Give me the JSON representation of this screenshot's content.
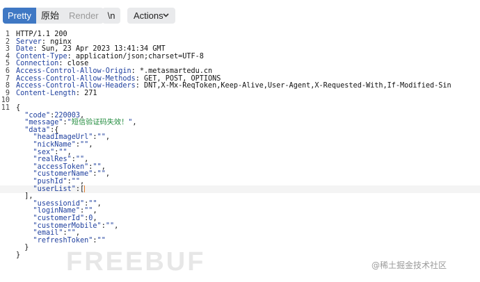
{
  "toolbar": {
    "tabs": [
      "Pretty",
      "原始",
      "Render"
    ],
    "newline_label": "\\n",
    "actions_label": "Actions"
  },
  "headers": [
    {
      "n": "1",
      "text": "HTTP/1.1 200"
    },
    {
      "n": "2",
      "name": "Server",
      "value": " nginx"
    },
    {
      "n": "3",
      "name": "Date",
      "value": " Sun, 23 Apr 2023 13:41:34 GMT"
    },
    {
      "n": "4",
      "name": "Content-Type",
      "value": " application/json;charset=UTF-8"
    },
    {
      "n": "5",
      "name": "Connection",
      "value": " close"
    },
    {
      "n": "6",
      "name": "Access-Control-Allow-Origin",
      "value": " *.metasmartedu.cn"
    },
    {
      "n": "7",
      "name": "Access-Control-Allow-Methods",
      "value": " GET, POST, OPTIONS"
    },
    {
      "n": "8",
      "name": "Access-Control-Allow-Headers",
      "value": " DNT,X-Mx-ReqToken,Keep-Alive,User-Agent,X-Requested-With,If-Modified-Sin"
    },
    {
      "n": "9",
      "name": "Content-Length",
      "value": " 271"
    },
    {
      "n": "10",
      "text": ""
    }
  ],
  "json_lines": [
    {
      "n": "11",
      "indent": "",
      "open": "{"
    },
    {
      "n": "",
      "indent": "  ",
      "key": "code",
      "num": "220003",
      "tail": ","
    },
    {
      "n": "",
      "indent": "  ",
      "key": "message",
      "str": "短信验证码失效！",
      "tail": ","
    },
    {
      "n": "",
      "indent": "  ",
      "key": "data",
      "tail": "{"
    },
    {
      "n": "",
      "indent": "    ",
      "key": "headImageUrl",
      "str": "",
      "tail": ","
    },
    {
      "n": "",
      "indent": "    ",
      "key": "nickName",
      "str": "",
      "tail": ","
    },
    {
      "n": "",
      "indent": "    ",
      "key": "sex",
      "str": "",
      "tail": ","
    },
    {
      "n": "",
      "indent": "    ",
      "key": "realRes",
      "str": "",
      "tail": ","
    },
    {
      "n": "",
      "indent": "    ",
      "key": "accessToken",
      "str": "",
      "tail": ","
    },
    {
      "n": "",
      "indent": "    ",
      "key": "customerName",
      "str": "",
      "tail": ","
    },
    {
      "n": "",
      "indent": "    ",
      "key": "pushId",
      "str": "",
      "tail": ","
    },
    {
      "n": "",
      "indent": "    ",
      "key": "userList",
      "tail": "[",
      "cursor": true,
      "hl": true
    },
    {
      "n": "",
      "indent": "  ",
      "open": "],"
    },
    {
      "n": "",
      "indent": "    ",
      "key": "usessionid",
      "str": "",
      "tail": ","
    },
    {
      "n": "",
      "indent": "    ",
      "key": "loginName",
      "str": "",
      "tail": ","
    },
    {
      "n": "",
      "indent": "    ",
      "key": "customerId",
      "num": "0",
      "tail": ","
    },
    {
      "n": "",
      "indent": "    ",
      "key": "customerMobile",
      "str": "",
      "tail": ","
    },
    {
      "n": "",
      "indent": "    ",
      "key": "email",
      "str": "",
      "tail": ","
    },
    {
      "n": "",
      "indent": "    ",
      "key": "refreshToken",
      "str": "",
      "tail": ""
    },
    {
      "n": "",
      "indent": "  ",
      "open": "}"
    },
    {
      "n": "",
      "indent": "",
      "open": "}"
    }
  ],
  "watermark": "FREEBUF",
  "badge": "@稀土掘金技术社区"
}
